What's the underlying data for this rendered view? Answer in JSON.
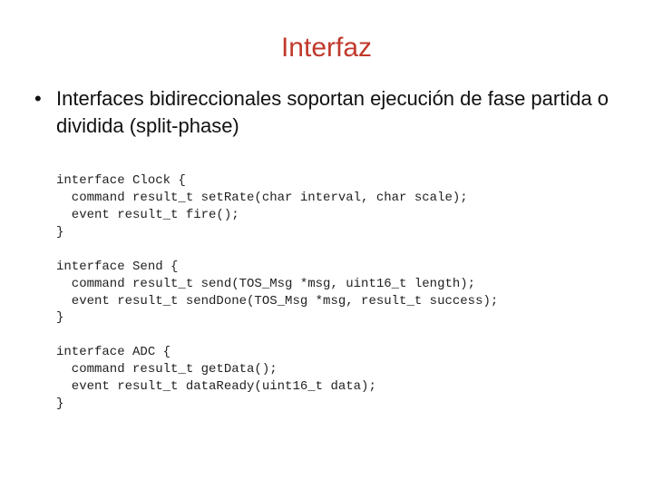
{
  "title": "Interfaz",
  "bullet": {
    "item1": "Interfaces bidireccionales soportan ejecución de fase partida o dividida (split-phase)"
  },
  "code": {
    "line01": "interface Clock {",
    "line02": "  command result_t setRate(char interval, char scale);",
    "line03": "  event result_t fire();",
    "line04": "}",
    "line05": "",
    "line06": "interface Send {",
    "line07": "  command result_t send(TOS_Msg *msg, uint16_t length);",
    "line08": "  event result_t sendDone(TOS_Msg *msg, result_t success);",
    "line09": "}",
    "line10": "",
    "line11": "interface ADC {",
    "line12": "  command result_t getData();",
    "line13": "  event result_t dataReady(uint16_t data);",
    "line14": "}"
  }
}
